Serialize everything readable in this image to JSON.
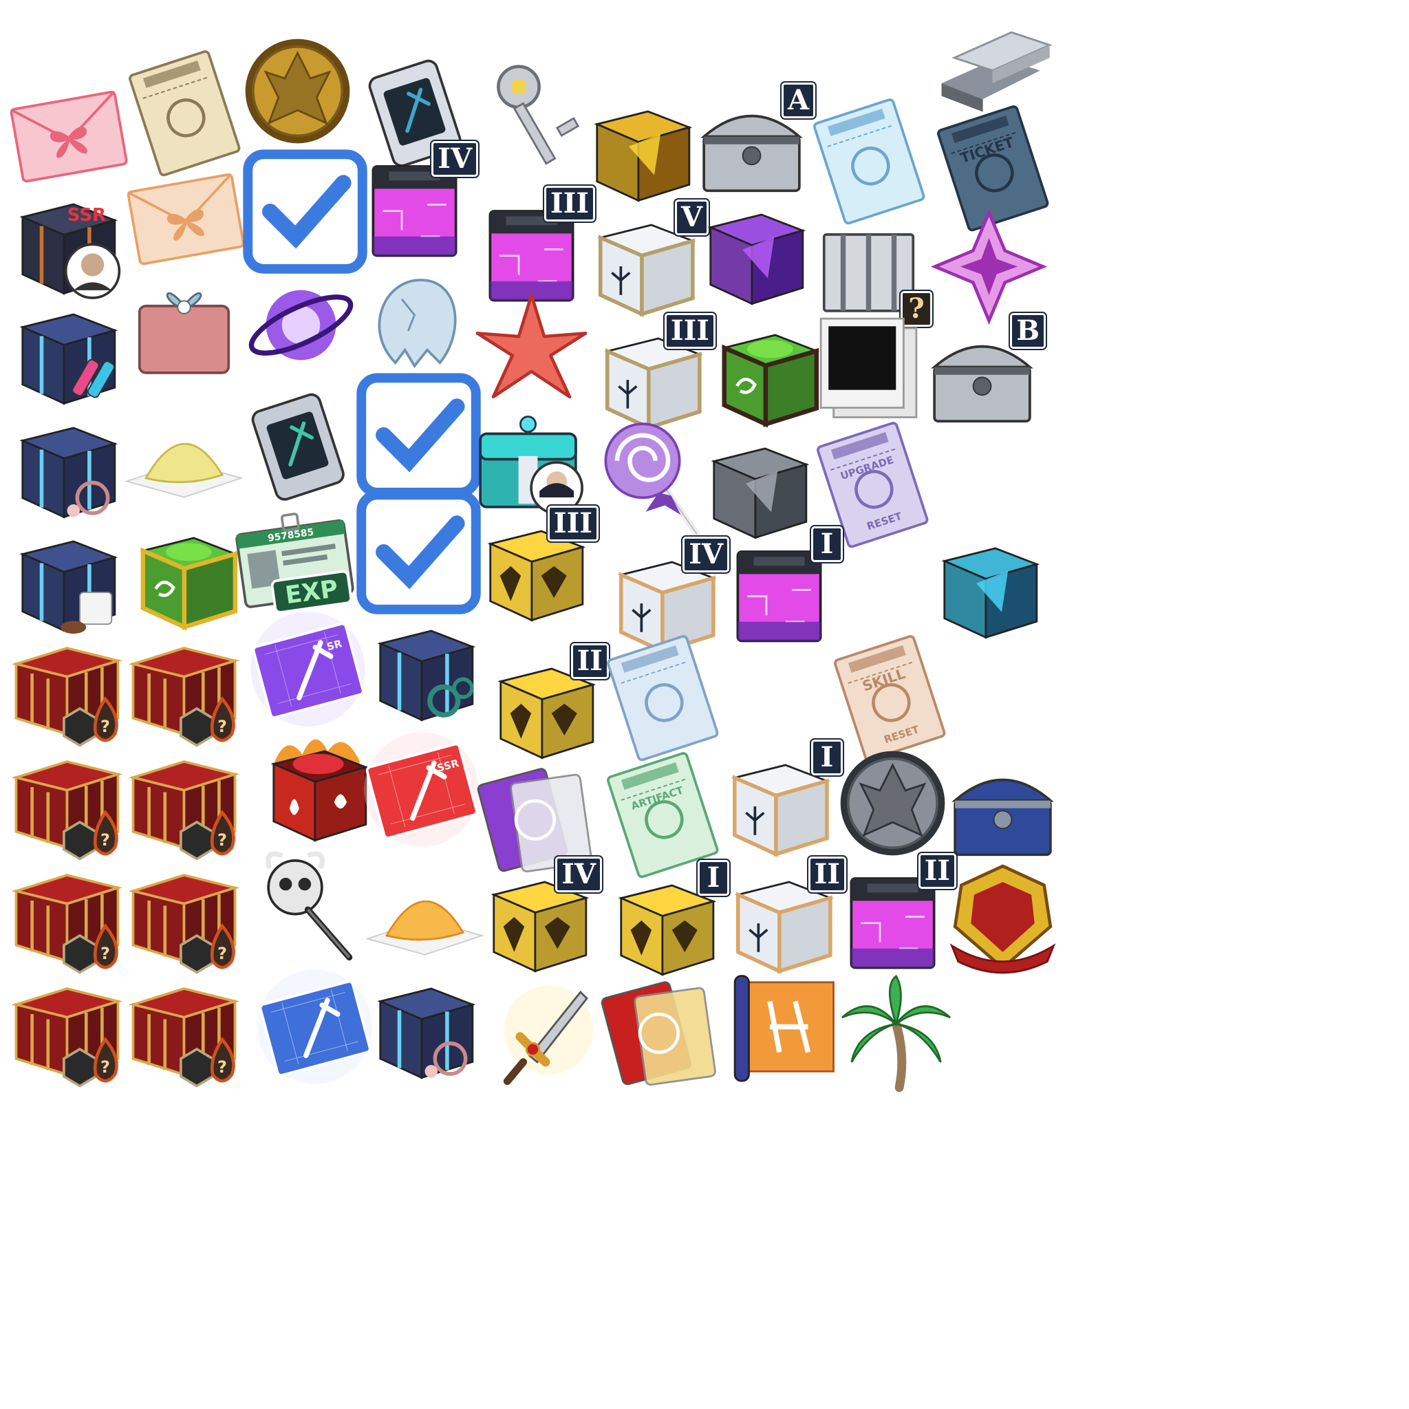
{
  "sheet": {
    "background": "#ffffff",
    "items": [
      {
        "kind": "envelope",
        "c1": "#f7c6cf",
        "c2": "#e8657c",
        "badge": ""
      },
      {
        "kind": "ticket",
        "c1": "#efe2bf",
        "c2": "#8a7a55",
        "badge": ""
      },
      {
        "kind": "coin",
        "c1": "#c99a2e",
        "c2": "#6a4a12",
        "badge": ""
      },
      {
        "kind": "card-case",
        "c1": "#d8dde6",
        "c2": "#3fa7c9",
        "badge": ""
      },
      {
        "kind": "key",
        "c1": "#c9ccd2",
        "c2": "#6b6f78",
        "badge": ""
      },
      {
        "kind": "bars",
        "c1": "#d3d7de",
        "c2": "#8a919c",
        "badge": ""
      },
      {
        "kind": "cube",
        "c1": "#e8b62c",
        "c2": "#8a5c10",
        "badge": ""
      },
      {
        "kind": "chest",
        "c1": "#b9bdc4",
        "c2": "#5c6068",
        "badge": "A"
      },
      {
        "kind": "ticket",
        "c1": "#d6eef7",
        "c2": "#6aa6d0",
        "badge": ""
      },
      {
        "kind": "ticket",
        "c1": "#4f6c86",
        "c2": "#243548",
        "badge": "",
        "text": "TICKET"
      },
      {
        "kind": "gift-box",
        "c1": "#2b2f44",
        "c2": "#c8722e",
        "badge": "SSR",
        "portrait": true
      },
      {
        "kind": "envelope",
        "c1": "#f7dcc4",
        "c2": "#e8a066",
        "badge": ""
      },
      {
        "kind": "ring-case",
        "c1": "#d8dce3",
        "c2": "#b02a2a",
        "badge": "",
        "check": true
      },
      {
        "kind": "neon-box",
        "c1": "#e24be8",
        "c2": "#5a2aa8",
        "badge": "IV"
      },
      {
        "kind": "neon-box",
        "c1": "#e24be8",
        "c2": "#5a2aa8",
        "badge": "III"
      },
      {
        "kind": "crystal-box",
        "c1": "#e7ecf3",
        "c2": "#b59f6a",
        "badge": "V"
      },
      {
        "kind": "cube",
        "c1": "#9b4fe0",
        "c2": "#4a1e8a",
        "badge": ""
      },
      {
        "kind": "crate",
        "c1": "#d4d7dc",
        "c2": "#6c7079",
        "badge": "?"
      },
      {
        "kind": "star-gem",
        "c1": "#e59ae8",
        "c2": "#9d2fb0",
        "badge": ""
      },
      {
        "kind": "gift-box",
        "c1": "#2e3a66",
        "c2": "#6bd0f0",
        "badge": "",
        "vials": true
      },
      {
        "kind": "wrapped-gift",
        "c1": "#d98c8c",
        "c2": "#9cc9d6",
        "badge": ""
      },
      {
        "kind": "orb",
        "c1": "#9b5ae8",
        "c2": "#3a157a",
        "badge": ""
      },
      {
        "kind": "egg",
        "c1": "#cde0ee",
        "c2": "#6f93b0",
        "badge": ""
      },
      {
        "kind": "starfish",
        "c1": "#ec6a5c",
        "c2": "#b8322a",
        "badge": ""
      },
      {
        "kind": "crystal-box",
        "c1": "#e7ecf3",
        "c2": "#b59f6a",
        "badge": "III"
      },
      {
        "kind": "rune-cube",
        "c1": "#5cc43a",
        "c2": "#3a2418",
        "badge": ""
      },
      {
        "kind": "photo",
        "c1": "#f3f3f3",
        "c2": "#111111",
        "badge": ""
      },
      {
        "kind": "chest",
        "c1": "#b9bdc4",
        "c2": "#5c6068",
        "badge": "B"
      },
      {
        "kind": "gift-box",
        "c1": "#2e3a66",
        "c2": "#6bd0f0",
        "badge": "",
        "jewel": true
      },
      {
        "kind": "powder",
        "c1": "#efe58a",
        "c2": "#c8b84a",
        "badge": ""
      },
      {
        "kind": "card-case",
        "c1": "#c5ccd6",
        "c2": "#3fc7a8",
        "badge": ""
      },
      {
        "kind": "ring-case",
        "c1": "#d8dce3",
        "c2": "#6a2fb8",
        "badge": "",
        "check": true
      },
      {
        "kind": "chest-box",
        "c1": "#2fb3b0",
        "c2": "#e7ecf3",
        "badge": "",
        "portrait": true
      },
      {
        "kind": "lollipop",
        "c1": "#b78ae3",
        "c2": "#7a3fb6",
        "badge": ""
      },
      {
        "kind": "cube",
        "c1": "#8a9099",
        "c2": "#444a52",
        "badge": ""
      },
      {
        "kind": "ticket",
        "c1": "#d9d2ef",
        "c2": "#7d6ab8",
        "badge": "",
        "text": "UPGRADE",
        "text2": "RESET"
      },
      {
        "kind": "gift-box",
        "c1": "#2e3a66",
        "c2": "#6bd0f0",
        "badge": "",
        "clothes": true
      },
      {
        "kind": "rune-cube",
        "c1": "#5cc43a",
        "c2": "#e0b52a",
        "badge": ""
      },
      {
        "kind": "id-card",
        "c1": "#d9f0dc",
        "c2": "#2f8e55",
        "badge": "",
        "text": "EXP",
        "text2": "9578585"
      },
      {
        "kind": "ring-case",
        "c1": "#d8dce3",
        "c2": "#b02a2a",
        "badge": "",
        "check": true
      },
      {
        "kind": "gold-box",
        "c1": "#e8c23a",
        "c2": "#3a2a10",
        "badge": "III"
      },
      {
        "kind": "crystal-box",
        "c1": "#e7ecf3",
        "c2": "#d8a66a",
        "badge": "IV"
      },
      {
        "kind": "neon-box",
        "c1": "#e24be8",
        "c2": "#5a2aa8",
        "badge": "I"
      },
      {
        "kind": "cube",
        "c1": "#3fb6d6",
        "c2": "#1b4f70",
        "badge": ""
      },
      {
        "kind": "red-crate",
        "c1": "#8a1a1a",
        "c2": "#d9a84a",
        "badge": "",
        "token": "?"
      },
      {
        "kind": "red-crate",
        "c1": "#8a1a1a",
        "c2": "#d9a84a",
        "badge": "",
        "token": "?"
      },
      {
        "kind": "blueprint",
        "c1": "#8a4ae8",
        "c2": "#dcd0ff",
        "badge": "",
        "text": "SR"
      },
      {
        "kind": "gift-box",
        "c1": "#2e3a66",
        "c2": "#6bd0f0",
        "badge": "",
        "chain": true
      },
      {
        "kind": "gold-box",
        "c1": "#e8c23a",
        "c2": "#3a2a10",
        "badge": "II"
      },
      {
        "kind": "ticket",
        "c1": "#dceaf6",
        "c2": "#7fa3c6",
        "badge": ""
      },
      {
        "kind": "ticket",
        "c1": "#f2dccb",
        "c2": "#b88968",
        "badge": "",
        "text": "SKILL",
        "text2": "RESET"
      },
      {
        "kind": "red-crate",
        "c1": "#8a1a1a",
        "c2": "#d9a84a",
        "badge": "",
        "token": "?"
      },
      {
        "kind": "red-crate",
        "c1": "#8a1a1a",
        "c2": "#d9a84a",
        "badge": "",
        "token": "?"
      },
      {
        "kind": "fire-box",
        "c1": "#c8281e",
        "c2": "#f29a2e",
        "badge": ""
      },
      {
        "kind": "blueprint",
        "c1": "#e8383a",
        "c2": "#ffd6d6",
        "badge": "",
        "text": "SSR"
      },
      {
        "kind": "cards",
        "c1": "#8a3fd0",
        "c2": "#e7e7ef",
        "badge": ""
      },
      {
        "kind": "ticket",
        "c1": "#d9f0dc",
        "c2": "#5aa877",
        "badge": "",
        "text": "ARTIFACT"
      },
      {
        "kind": "crystal-box",
        "c1": "#e7ecf3",
        "c2": "#d8a66a",
        "badge": "I"
      },
      {
        "kind": "coin",
        "c1": "#8a8f99",
        "c2": "#2f333a",
        "badge": ""
      },
      {
        "kind": "chest",
        "c1": "#2f4a9a",
        "c2": "#8a95a8",
        "badge": ""
      },
      {
        "kind": "red-crate",
        "c1": "#8a1a1a",
        "c2": "#d9a84a",
        "badge": "",
        "token": "?"
      },
      {
        "kind": "red-crate",
        "c1": "#8a1a1a",
        "c2": "#d9a84a",
        "badge": "",
        "token": "?"
      },
      {
        "kind": "skull-key",
        "c1": "#e7e7e7",
        "c2": "#2a2a2a",
        "badge": ""
      },
      {
        "kind": "powder",
        "c1": "#f6b94a",
        "c2": "#e08a1e",
        "badge": ""
      },
      {
        "kind": "gold-box",
        "c1": "#e8c23a",
        "c2": "#3a2a10",
        "badge": "IV"
      },
      {
        "kind": "gold-box",
        "c1": "#e8c23a",
        "c2": "#3a2a10",
        "badge": "I"
      },
      {
        "kind": "crystal-box",
        "c1": "#e7ecf3",
        "c2": "#d8a66a",
        "badge": "II"
      },
      {
        "kind": "neon-box",
        "c1": "#e24be8",
        "c2": "#5a2aa8",
        "badge": "II"
      },
      {
        "kind": "crest",
        "c1": "#e0b52a",
        "c2": "#b0201e",
        "badge": ""
      },
      {
        "kind": "red-crate",
        "c1": "#8a1a1a",
        "c2": "#d9a84a",
        "badge": "",
        "token": "?"
      },
      {
        "kind": "red-crate",
        "c1": "#8a1a1a",
        "c2": "#d9a84a",
        "badge": "",
        "token": "?"
      },
      {
        "kind": "blueprint",
        "c1": "#3f6fd8",
        "c2": "#dfe8ff",
        "badge": ""
      },
      {
        "kind": "gift-box",
        "c1": "#2e3a66",
        "c2": "#6bd0f0",
        "badge": "",
        "festive": true
      },
      {
        "kind": "dagger",
        "c1": "#c9ccd2",
        "c2": "#d99a2e",
        "badge": ""
      },
      {
        "kind": "cards",
        "c1": "#c8201e",
        "c2": "#f2d98a",
        "badge": ""
      },
      {
        "kind": "scroll",
        "c1": "#f29a3a",
        "c2": "#3a3f9a",
        "badge": ""
      },
      {
        "kind": "palm",
        "c1": "#3fb050",
        "c2": "#9a7a55",
        "badge": ""
      }
    ]
  }
}
